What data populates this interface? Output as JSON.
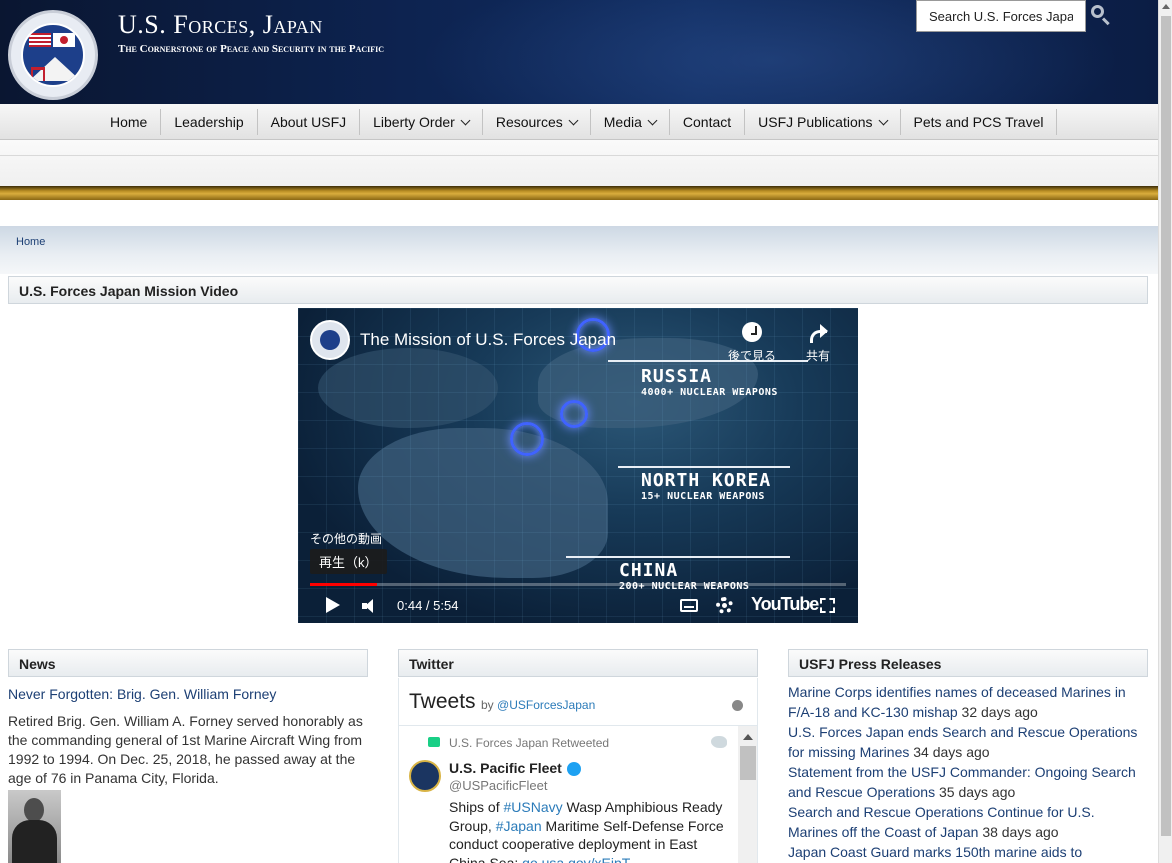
{
  "header": {
    "title": "U.S. Forces, Japan",
    "tagline": "The Cornerstone of Peace and Security in the Pacific",
    "search_placeholder": "Search U.S. Forces Japan"
  },
  "nav": {
    "items": [
      {
        "label": "Home",
        "dropdown": false
      },
      {
        "label": "Leadership",
        "dropdown": false
      },
      {
        "label": "About USFJ",
        "dropdown": false
      },
      {
        "label": "Liberty Order",
        "dropdown": true
      },
      {
        "label": "Resources",
        "dropdown": true
      },
      {
        "label": "Media",
        "dropdown": true
      },
      {
        "label": "Contact",
        "dropdown": false
      },
      {
        "label": "USFJ Publications",
        "dropdown": true
      },
      {
        "label": "Pets and PCS Travel",
        "dropdown": false
      }
    ]
  },
  "breadcrumb": {
    "home": "Home"
  },
  "video_section": {
    "heading": "U.S. Forces Japan Mission Video",
    "title": "The Mission of U.S. Forces Japan",
    "watch_later": "後で見る",
    "share": "共有",
    "more_videos": "その他の動画",
    "play_tooltip": "再生（k）",
    "time": "0:44 / 5:54",
    "progress_fraction": 0.125,
    "youtube": "YouTube",
    "overlays": [
      {
        "name": "RUSSIA",
        "detail": "4000+ NUCLEAR WEAPONS"
      },
      {
        "name": "NORTH KOREA",
        "detail": "15+ NUCLEAR WEAPONS"
      },
      {
        "name": "CHINA",
        "detail": "200+ NUCLEAR WEAPONS"
      }
    ]
  },
  "news": {
    "heading": "News",
    "link": "Never Forgotten: Brig. Gen. William Forney",
    "body": "Retired Brig. Gen. William A. Forney served honorably as the commanding general of 1st Marine Aircraft Wing from 1992 to 1994. On Dec. 25, 2018, he passed away at the age of 76 in Panama City, Florida."
  },
  "twitter": {
    "heading": "Twitter",
    "tweets_label": "Tweets",
    "by": "by",
    "by_handle": "@USForcesJapan",
    "retweeted": "U.S. Forces Japan Retweeted",
    "name": "U.S. Pacific Fleet",
    "handle": "@USPacificFleet",
    "text_parts": [
      {
        "t": "Ships of ",
        "hl": false
      },
      {
        "t": "#USNavy",
        "hl": true
      },
      {
        "t": " Wasp Amphibious Ready Group, ",
        "hl": false
      },
      {
        "t": "#Japan",
        "hl": true
      },
      {
        "t": " Maritime Self-Defense Force conduct cooperative deployment in East China Sea: ",
        "hl": false
      },
      {
        "t": "go.usa.gov/xEjpT",
        "hl": true
      }
    ]
  },
  "press": {
    "heading": "USFJ Press Releases",
    "items": [
      {
        "title": "Marine Corps identifies names of deceased Marines in F/A-18 and KC-130 mishap",
        "ago": "32 days ago"
      },
      {
        "title": "U.S. Forces Japan ends Search and Rescue Operations for missing Marines",
        "ago": "34 days ago"
      },
      {
        "title": "Statement from the USFJ Commander: Ongoing Search and Rescue Operations",
        "ago": "35 days ago"
      },
      {
        "title": "Search and Rescue Operations Continue for U.S. Marines off the Coast of Japan",
        "ago": "38 days ago"
      },
      {
        "title": "Japan Coast Guard marks 150th marine aids to",
        "ago": ""
      }
    ]
  }
}
